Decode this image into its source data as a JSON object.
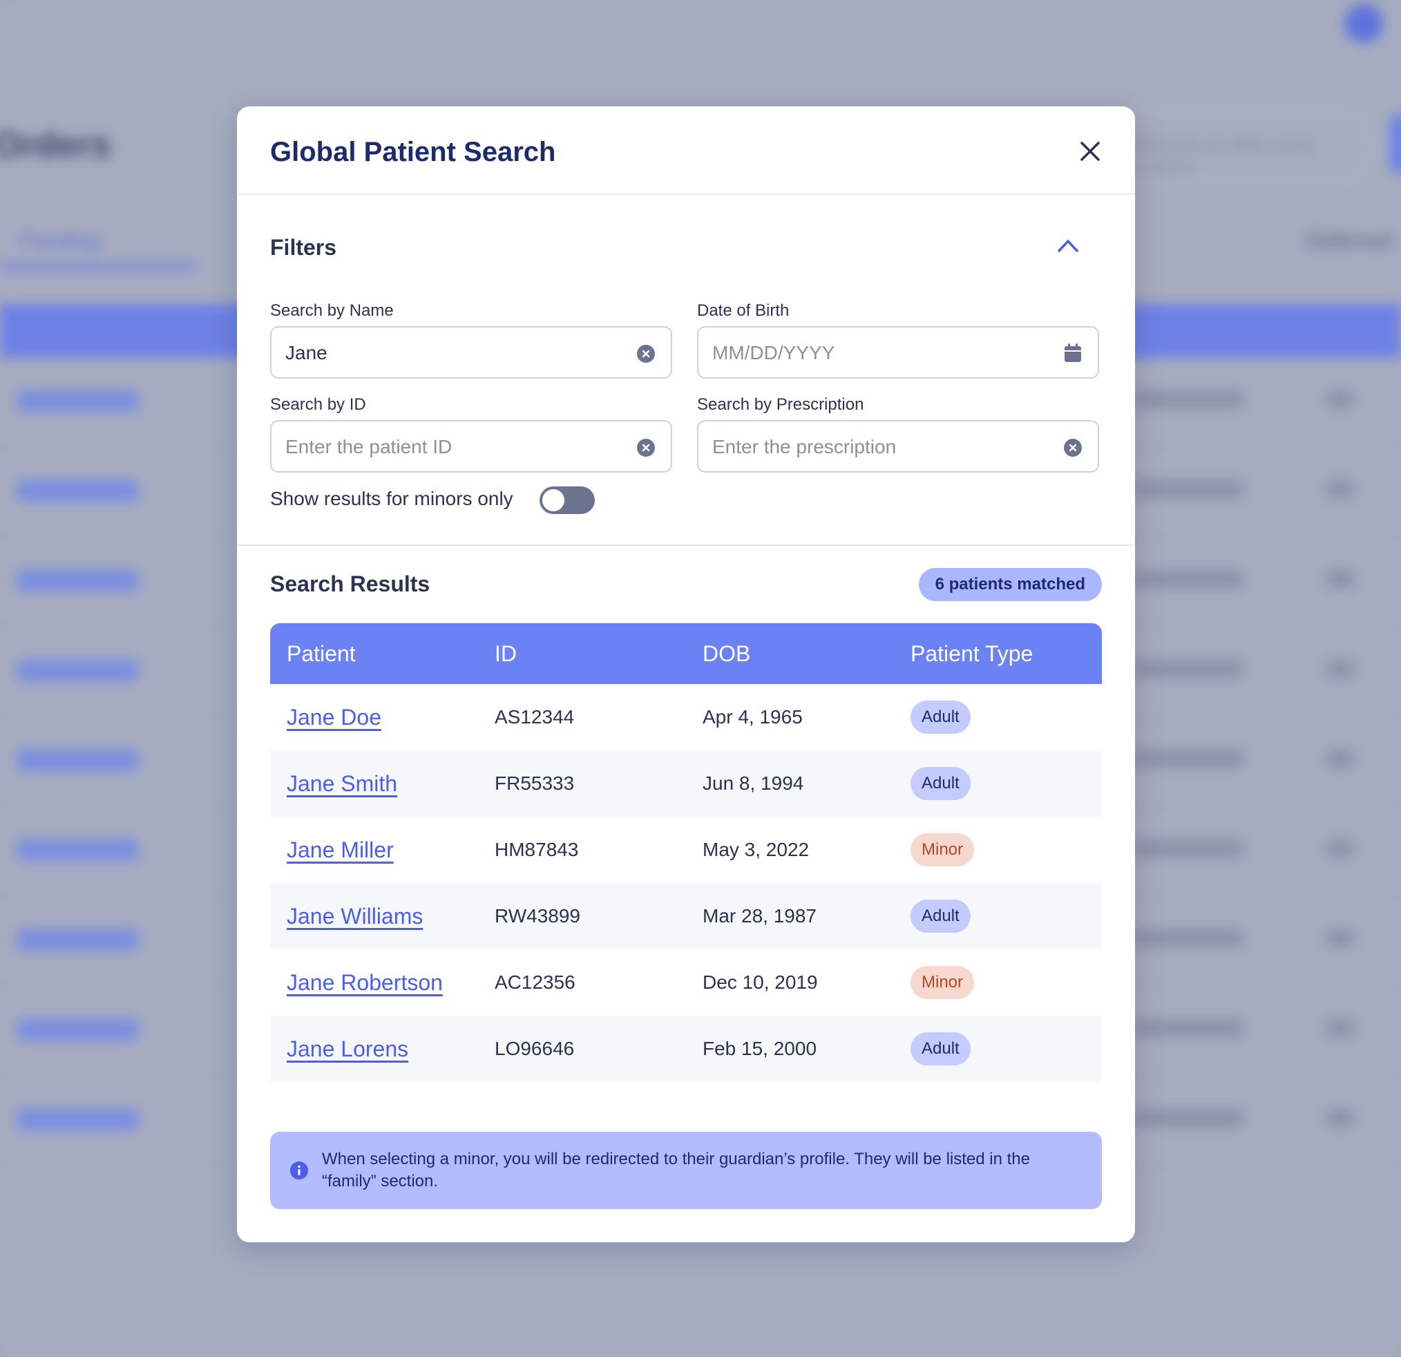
{
  "background": {
    "page_title": "Orders",
    "tabs": [
      "Pending",
      "Deferred"
    ],
    "search_placeholder": "Search or filter your orders"
  },
  "modal": {
    "title": "Global Patient Search",
    "filters": {
      "title": "Filters",
      "name_label": "Search by Name",
      "name_value": "Jane",
      "dob_label": "Date of Birth",
      "dob_placeholder": "MM/DD/YYYY",
      "id_label": "Search by ID",
      "id_placeholder": "Enter the patient ID",
      "rx_label": "Search by Prescription",
      "rx_placeholder": "Enter the prescription",
      "minors_label": "Show results for minors only",
      "minors_enabled": false
    },
    "results": {
      "title": "Search Results",
      "match_badge": "6 patients matched",
      "columns": [
        "Patient",
        "ID",
        "DOB",
        "Patient Type"
      ],
      "rows": [
        {
          "name": "Jane Doe",
          "id": "AS12344",
          "dob": "Apr 4, 1965",
          "type": "Adult"
        },
        {
          "name": "Jane Smith",
          "id": "FR55333",
          "dob": "Jun 8, 1994",
          "type": "Adult"
        },
        {
          "name": "Jane Miller",
          "id": "HM87843",
          "dob": "May 3, 2022",
          "type": "Minor"
        },
        {
          "name": "Jane Williams",
          "id": "RW43899",
          "dob": "Mar 28, 1987",
          "type": "Adult"
        },
        {
          "name": "Jane Robertson",
          "id": "AC12356",
          "dob": "Dec 10, 2019",
          "type": "Minor"
        },
        {
          "name": "Jane Lorens",
          "id": "LO96646",
          "dob": "Feb 15, 2000",
          "type": "Adult"
        }
      ]
    },
    "info_text": "When selecting a minor, you will be redirected to their guardian’s profile. They will be listed in the “family” section."
  },
  "icons": {
    "close": "close-icon",
    "collapse": "chevron-up-icon",
    "clear": "clear-circle-icon",
    "calendar": "calendar-icon",
    "info": "info-icon"
  },
  "colors": {
    "accent": "#6b82f5",
    "title": "#1d2a6b",
    "link": "#4b5ee8",
    "adult_badge": "#c4ccff",
    "minor_badge": "#f7d8cf",
    "info_bg": "#b3bcff"
  }
}
